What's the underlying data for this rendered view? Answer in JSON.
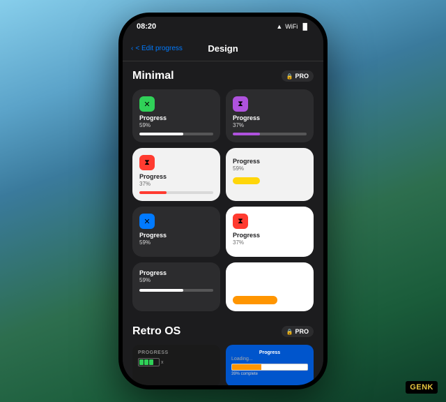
{
  "status_bar": {
    "time": "08:20",
    "signal": "▲",
    "wifi": "wifi",
    "battery": "battery"
  },
  "nav": {
    "back_label": "< Edit progress",
    "title": "Design"
  },
  "minimal_section": {
    "title": "Minimal",
    "pro_badge": "PRO",
    "lock": "🔒"
  },
  "widgets": [
    {
      "id": "w1",
      "theme": "dark",
      "icon_color": "green",
      "icon": "✕",
      "label": "Progress",
      "value": "59%",
      "progress": 59,
      "bar_color": "white"
    },
    {
      "id": "w2",
      "theme": "dark",
      "icon_color": "purple",
      "icon": "⧗",
      "label": "Progress",
      "value": "37%",
      "progress": 37,
      "bar_color": "purple"
    },
    {
      "id": "w3",
      "theme": "light",
      "icon_color": "red",
      "icon": "⧗",
      "label": "Progress",
      "value": "37%",
      "progress": 37,
      "bar_color": "red"
    },
    {
      "id": "w4",
      "theme": "light",
      "label": "Progress",
      "value": "59%",
      "bar_color": "yellow"
    },
    {
      "id": "w5_left",
      "theme": "dark",
      "icon_color": "blue",
      "icon": "✕",
      "label": "Progress",
      "value": "59%"
    },
    {
      "id": "w5_right",
      "theme": "white",
      "icon_color": "orange",
      "icon": "⧗",
      "label": "Progress",
      "value": "37%"
    },
    {
      "id": "w6",
      "theme": "dark",
      "label": "Progress",
      "value": "59%",
      "bar_color": "white"
    },
    {
      "id": "w7",
      "theme": "white",
      "bar_color": "orange"
    }
  ],
  "retro_section": {
    "title": "Retro OS",
    "pro_badge": "PRO",
    "lock": "🔒"
  },
  "retro_widgets": {
    "dark": {
      "label": "PROGRESS",
      "battery_cells": 3,
      "battery_x": "x"
    },
    "blue": {
      "label": "Progress",
      "loading": "Loading...",
      "progress": 39,
      "complete": "39% complete"
    }
  },
  "genk": "GENK"
}
